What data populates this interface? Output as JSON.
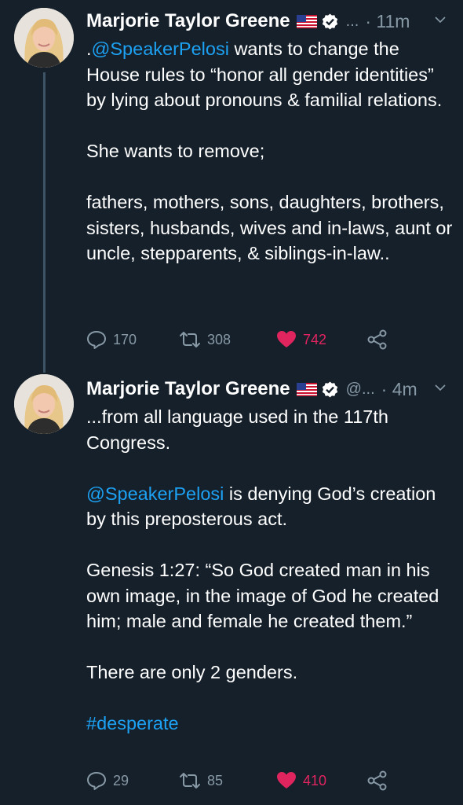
{
  "tweets": [
    {
      "author_name": "Marjorie Taylor Greene",
      "handle": "...",
      "time": "· 11m",
      "body": {
        "mention_prefix": ".",
        "mention": "@SpeakerPelosi",
        "line1_rest": " wants to change the House rules to “honor all gender identities” by lying about pronouns & familial relations.",
        "para2": "She wants to remove;",
        "para3": "fathers, mothers, sons, daughters, brothers, sisters, husbands, wives and in-laws, aunt or uncle, stepparents, & siblings-in-law.."
      },
      "replies": "170",
      "retweets": "308",
      "likes": "742"
    },
    {
      "author_name": "Marjorie Taylor Greene",
      "handle": "@...",
      "time": "· 4m",
      "body": {
        "para1": "...from all language used in the 117th Congress.",
        "mention": "@SpeakerPelosi",
        "para2_rest": " is denying God’s creation by this preposterous act.",
        "para3": "Genesis 1:27: “So God created man in his own image, in the image of God he created him; male and female he created them.”",
        "para4": "There are only 2 genders.",
        "hashtag": "#desperate"
      },
      "replies": "29",
      "retweets": "85",
      "likes": "410"
    }
  ],
  "colors": {
    "background": "#15202b",
    "text": "#ffffff",
    "secondary": "#8899a6",
    "link": "#1da1f2",
    "like": "#e0245e",
    "verified_bg": "#ffffff",
    "thread_line": "#3d5466"
  },
  "icons": {
    "reply": "reply-icon",
    "retweet": "retweet-icon",
    "like": "heart-icon",
    "share": "share-icon",
    "verified": "verified-badge-icon",
    "flag": "us-flag-icon",
    "chevron": "chevron-down-icon"
  }
}
